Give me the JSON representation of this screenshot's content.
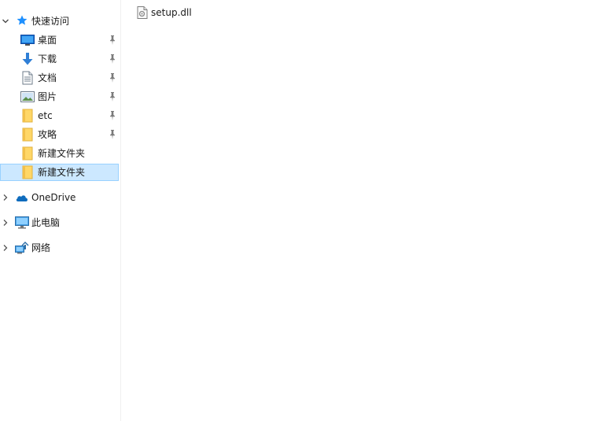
{
  "nav": {
    "quick_access": {
      "label": "快速访问",
      "items": [
        {
          "label": "桌面",
          "icon": "desktop-icon",
          "pinned": true
        },
        {
          "label": "下载",
          "icon": "download-icon",
          "pinned": true
        },
        {
          "label": "文档",
          "icon": "document-icon",
          "pinned": true
        },
        {
          "label": "图片",
          "icon": "picture-icon",
          "pinned": true
        },
        {
          "label": "etc",
          "icon": "folder-icon",
          "pinned": true
        },
        {
          "label": "攻略",
          "icon": "folder-icon",
          "pinned": true
        },
        {
          "label": "新建文件夹",
          "icon": "folder-icon",
          "pinned": false
        },
        {
          "label": "新建文件夹",
          "icon": "folder-icon",
          "pinned": false,
          "selected": true
        }
      ]
    },
    "onedrive": {
      "label": "OneDrive"
    },
    "this_pc": {
      "label": "此电脑"
    },
    "network": {
      "label": "网络"
    }
  },
  "files": [
    {
      "name": "setup.dll",
      "icon": "dll-file-icon"
    }
  ],
  "colors": {
    "selection_bg": "#cce8ff",
    "selection_border": "#99d1ff",
    "folder": "#ffd767",
    "accent": "#0078d7"
  }
}
